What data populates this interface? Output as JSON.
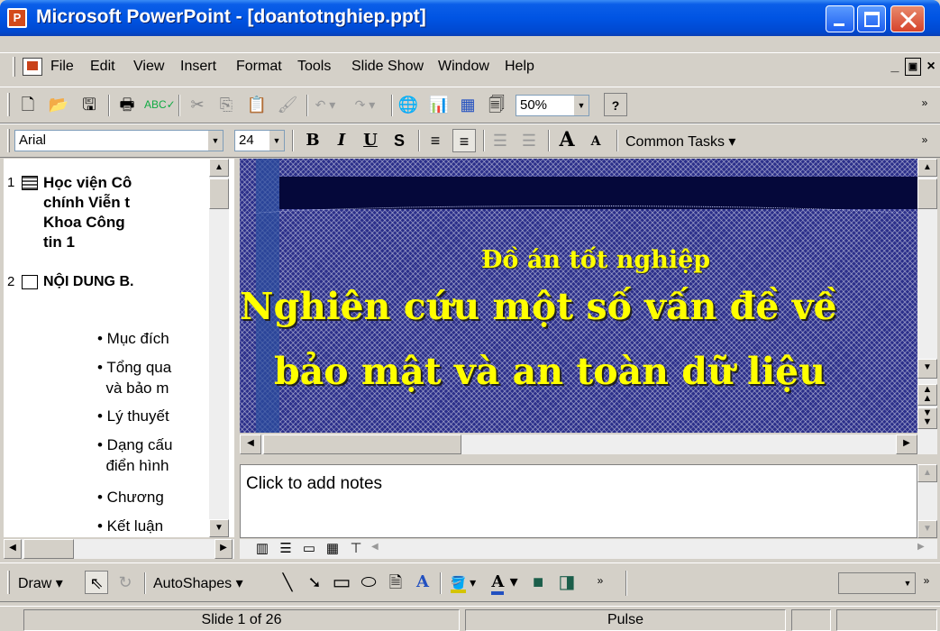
{
  "window": {
    "title": "Microsoft PowerPoint - [doantotnghiep.ppt]"
  },
  "menubar": {
    "items": [
      "File",
      "Edit",
      "View",
      "Insert",
      "Format",
      "Tools",
      "Slide Show",
      "Window",
      "Help"
    ]
  },
  "standard_toolbar": {
    "zoom": "50%"
  },
  "formatting_toolbar": {
    "font": "Arial",
    "size": "24",
    "common_tasks": "Common Tasks"
  },
  "outline": {
    "slides": [
      {
        "number": "1",
        "title_lines": [
          "Học viện Cô",
          "chính Viễn t",
          "Khoa Công",
          "tin 1"
        ]
      },
      {
        "number": "2",
        "title_lines": [
          "NỘI DUNG B."
        ]
      }
    ],
    "bullets": [
      "• Mục đích",
      "• Tổng qua",
      "  và bảo m",
      "• Lý thuyết",
      "• Dạng cấu",
      "  điển hình",
      "• Chương",
      "• Kết luận"
    ]
  },
  "slide": {
    "subtitle": "Đồ án tốt nghiệp",
    "title_line1": "Nghiên cứu một số vấn đề về",
    "title_line2": "bảo mật và an toàn dữ liệu",
    "bg_color": "#2b2f8a",
    "title_color": "#ffff00"
  },
  "notes": {
    "placeholder": "Click to add notes"
  },
  "drawing_toolbar": {
    "draw": "Draw",
    "autoshapes": "AutoShapes"
  },
  "statusbar": {
    "slide_info": "Slide 1 of 26",
    "design": "Pulse"
  }
}
